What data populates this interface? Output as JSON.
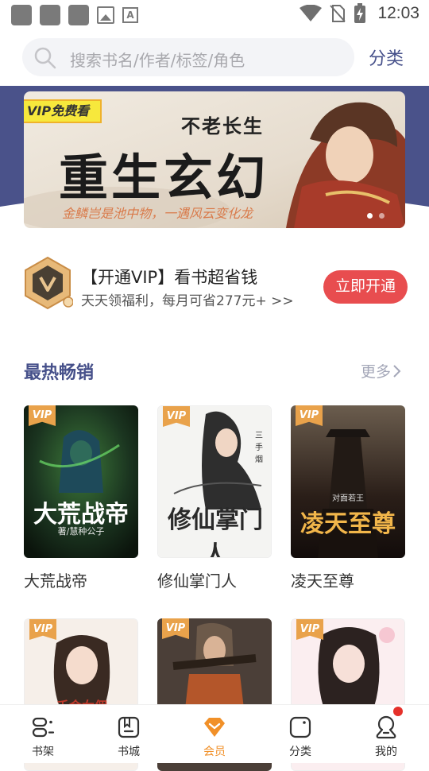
{
  "status_bar": {
    "time": "12:03"
  },
  "search": {
    "placeholder": "搜索书名/作者/标签/角色",
    "category_label": "分类"
  },
  "banner": {
    "vip_tag": "VIP免费看",
    "subtitle": "不老长生",
    "title": "重生玄幻",
    "slogan": "金鳞岂是池中物，一遇风云变化龙",
    "slide_count": 2,
    "active_slide": 1
  },
  "vip_promo": {
    "title": "【开通VIP】看书超省钱",
    "description": "天天领福利，每月可省277元+ >>",
    "button_label": "立即开通"
  },
  "section": {
    "title": "最热畅销",
    "more_label": "更多"
  },
  "books": [
    {
      "name": "大荒战帝",
      "vip_label": "VIP",
      "cover_title": "大荒战帝",
      "cover_author": "著/慧种公子"
    },
    {
      "name": "修仙掌门人",
      "vip_label": "VIP",
      "cover_title": "修仙掌门人",
      "cover_author": "三手烟"
    },
    {
      "name": "凌天至尊",
      "vip_label": "VIP",
      "cover_title": "凌天至尊",
      "cover_author": "对面若王"
    },
    {
      "name": "",
      "vip_label": "VIP",
      "cover_title": "千金女佣",
      "cover_author": ""
    },
    {
      "name": "",
      "vip_label": "VIP",
      "cover_title": "",
      "cover_author": ""
    },
    {
      "name": "",
      "vip_label": "VIP",
      "cover_title": "",
      "cover_author": ""
    }
  ],
  "bottom_nav": [
    {
      "label": "书架",
      "icon": "bookshelf-icon"
    },
    {
      "label": "书城",
      "icon": "bookstore-icon"
    },
    {
      "label": "会员",
      "icon": "member-diamond-icon",
      "active": true
    },
    {
      "label": "分类",
      "icon": "category-icon"
    },
    {
      "label": "我的",
      "icon": "profile-icon",
      "badge": true
    }
  ],
  "colors": {
    "accent": "#46508a",
    "member_active": "#f19028",
    "vip_button": "#e84d4f",
    "banner_wave": "#4a528a",
    "vip_tag": "#f7e83c"
  }
}
